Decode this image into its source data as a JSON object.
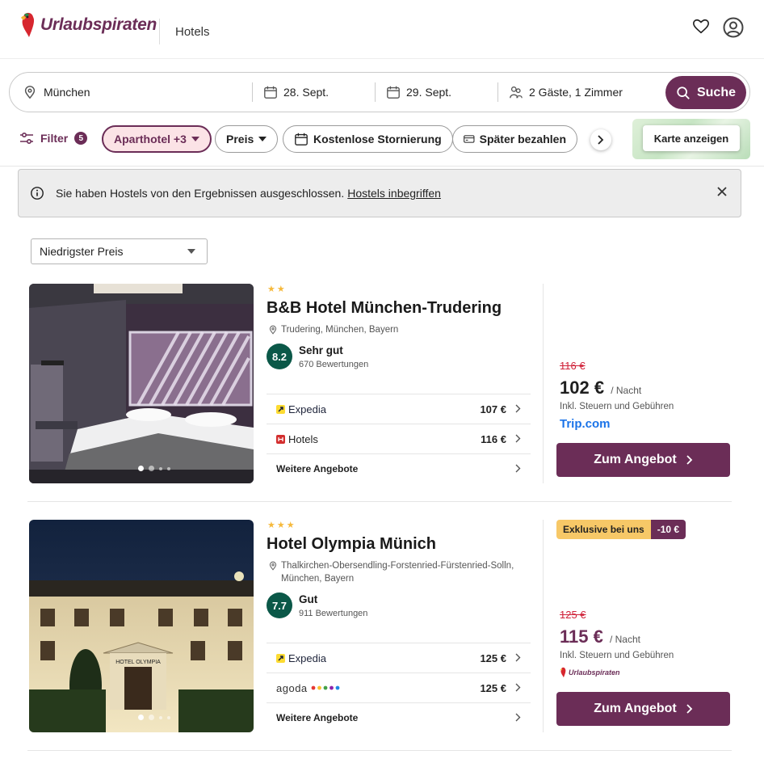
{
  "header": {
    "brand": "Urlaubspiraten",
    "section": "Hotels"
  },
  "search": {
    "destination": "München",
    "checkin": "28. Sept.",
    "checkout": "29. Sept.",
    "guests": "2 Gäste, 1 Zimmer",
    "button": "Suche"
  },
  "filters": {
    "label": "Filter",
    "count": "5",
    "chips": [
      "Aparthotel +3",
      "Preis",
      "Kostenlose Stornierung",
      "Später bezahlen"
    ],
    "map_button": "Karte anzeigen"
  },
  "notice": {
    "text": "Sie haben Hostels von den Ergebnissen ausgeschlossen.",
    "link": "Hostels inbegriffen"
  },
  "sort": {
    "selected": "Niedrigster Preis"
  },
  "hotels": [
    {
      "stars": "★★",
      "name": "B&B Hotel München-Trudering",
      "location": "Trudering, München, Bayern",
      "score": "8.2",
      "score_label": "Sehr gut",
      "reviews": "670 Bewertungen",
      "offers": [
        {
          "provider": "Expedia",
          "price": "107 €"
        },
        {
          "provider": "Hotels",
          "price": "116 €"
        }
      ],
      "more": "Weitere Angebote",
      "old_price": "116 €",
      "price": "102 €",
      "per": "/ Nacht",
      "tax": "Inkl. Steuern und Gebühren",
      "source": "Trip.com",
      "cta": "Zum Angebot"
    },
    {
      "stars": "★★★",
      "name": "Hotel Olympia Münich",
      "location": "Thalkirchen-Obersendling-Forstenried-Fürstenried-Solln, München, Bayern",
      "score": "7.7",
      "score_label": "Gut",
      "reviews": "911 Bewertungen",
      "badge": "Exklusive bei uns",
      "badge_discount": "-10 €",
      "offers": [
        {
          "provider": "Expedia",
          "price": "125 €"
        },
        {
          "provider": "agoda",
          "price": "125 €"
        }
      ],
      "more": "Weitere Angebote",
      "old_price": "125 €",
      "price": "115 €",
      "per": "/ Nacht",
      "tax": "Inkl. Steuern und Gebühren",
      "source": "Urlaubspiraten",
      "cta": "Zum Angebot",
      "hotel_sign": "HOTEL OLYMPIA"
    }
  ],
  "colors": {
    "brand": "#6b2d57",
    "rating": "#0b5848",
    "old_price": "#d0243b",
    "star": "#f6b93b"
  }
}
